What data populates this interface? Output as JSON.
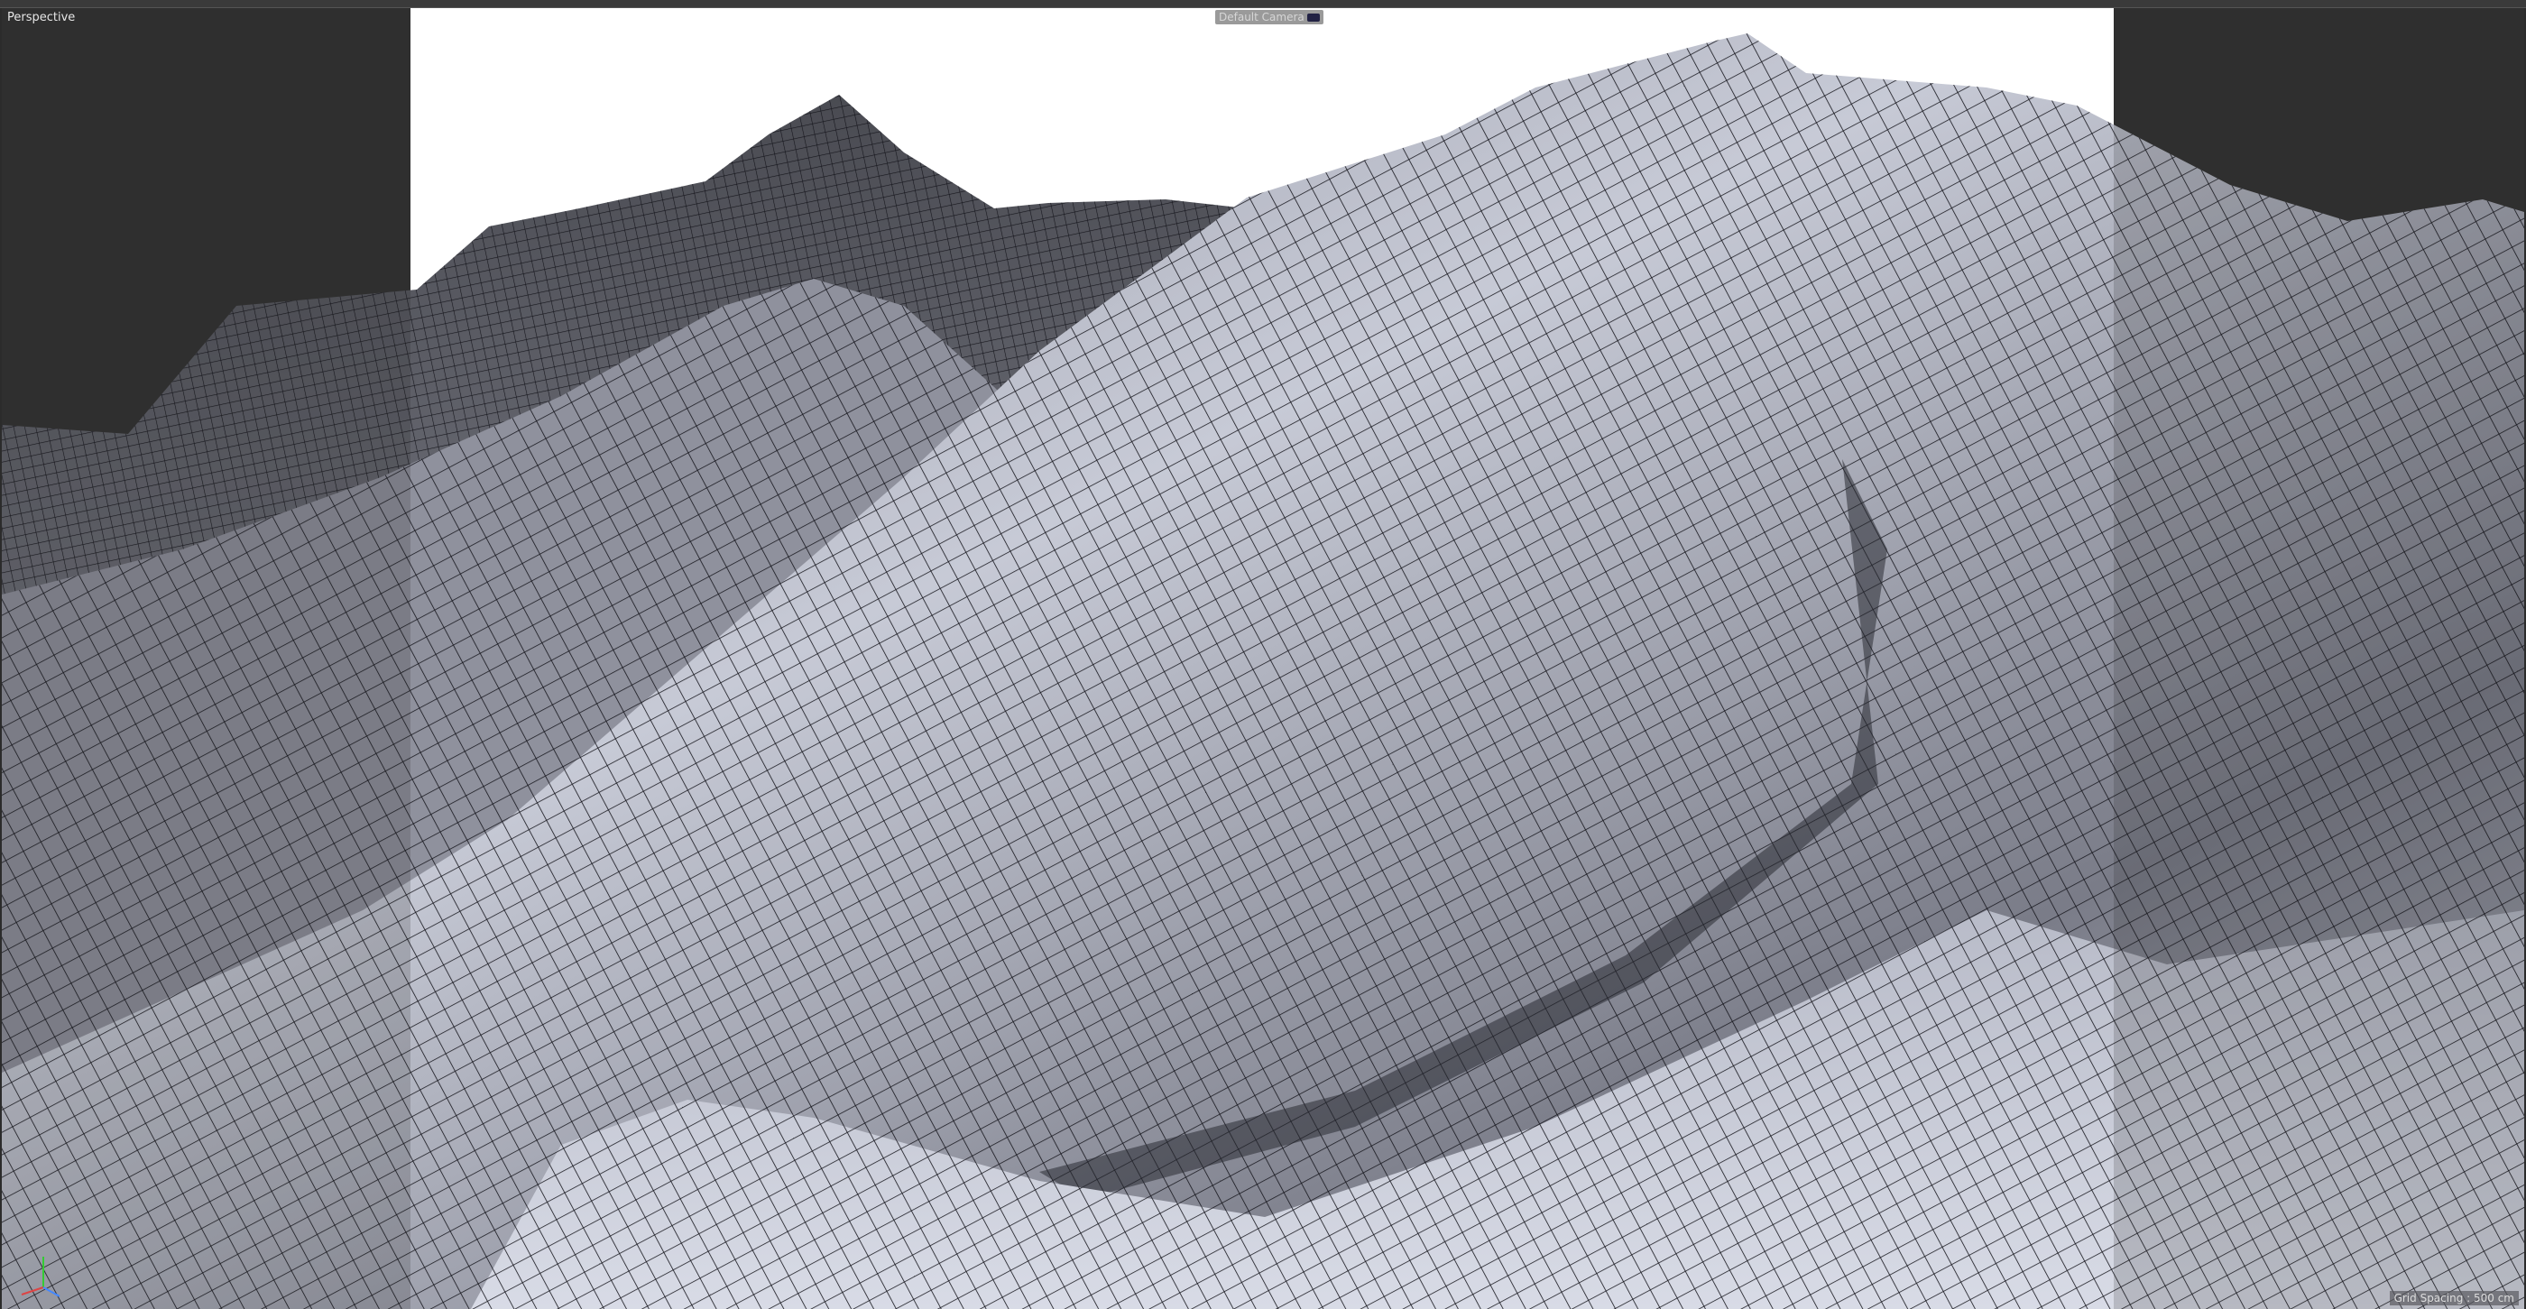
{
  "viewport": {
    "title": "Perspective",
    "camera": "Default Camera",
    "grid_spacing": "Grid Spacing : 500 cm",
    "axis": {
      "x": "X",
      "y": "Y",
      "z": "Z"
    }
  },
  "colors": {
    "background": "#333333",
    "sky": "#ffffff",
    "wire": "#1a1a22",
    "surface_light": "#c9ccd8",
    "surface_dark": "#5a5c66"
  }
}
